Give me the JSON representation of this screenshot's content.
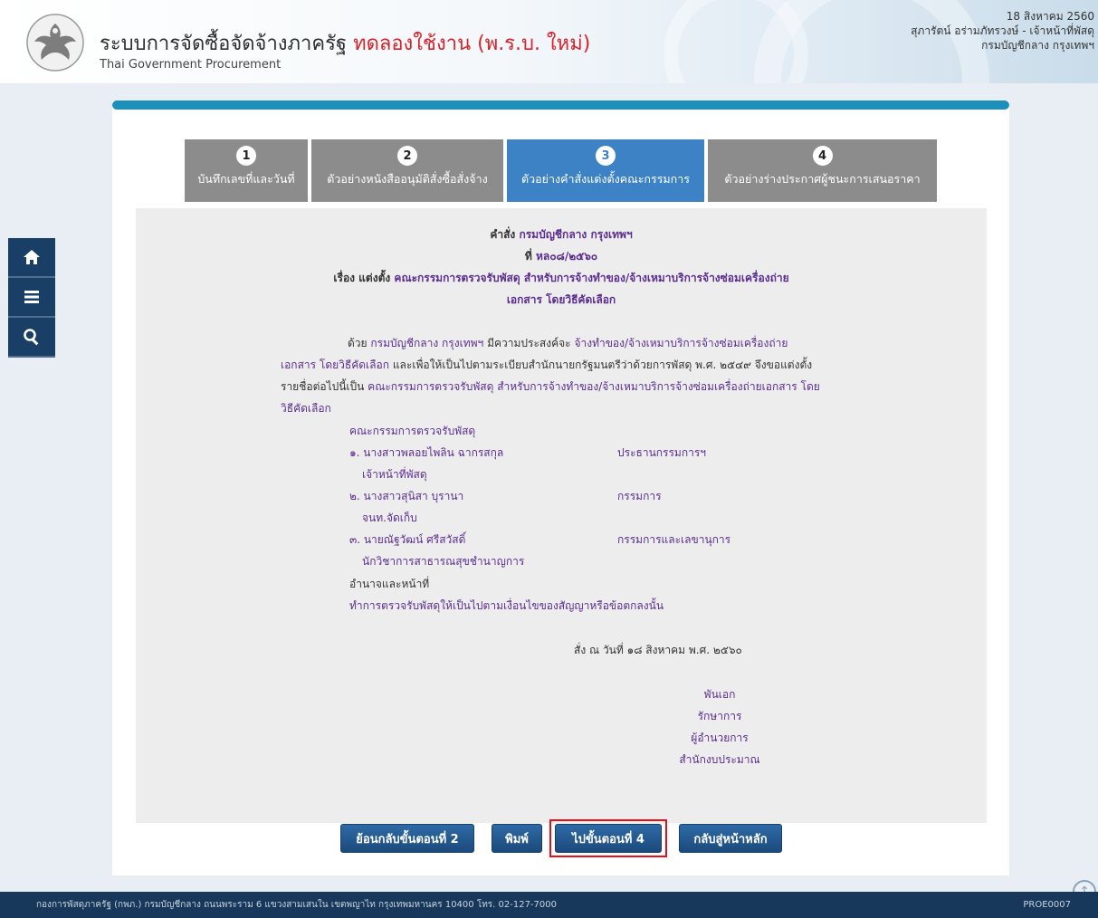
{
  "header": {
    "title": "ระบบการจัดซื้อจัดจ้างภาครัฐ",
    "trial_label": "ทดลองใช้งาน (พ.ร.บ. ใหม่)",
    "subtitle": "Thai Government Procurement",
    "date": "18 สิงหาคม 2560",
    "user": "สุภารัตน์ อร่ามภัทรวงษ์ - เจ้าหน้าที่พัสดุ",
    "department": "กรมบัญชีกลาง กรุงเทพฯ"
  },
  "leftnav": {
    "items": [
      {
        "icon": "home-icon"
      },
      {
        "icon": "menu-icon"
      },
      {
        "icon": "search-icon"
      }
    ]
  },
  "steps": [
    {
      "number": "1",
      "label": "บันทึกเลขที่และวันที่",
      "active": false
    },
    {
      "number": "2",
      "label": "ตัวอย่างหนังสืออนุมัติสั่งซื้อสั่งจ้าง",
      "active": false
    },
    {
      "number": "3",
      "label": "ตัวอย่างคำสั่งแต่งตั้งคณะกรรมการ",
      "active": true
    },
    {
      "number": "4",
      "label": "ตัวอย่างร่างประกาศผู้ชนะการเสนอราคา",
      "active": false
    }
  ],
  "document": {
    "order_prefix": "คำสั่ง",
    "order_dept": "กรมบัญชีกลาง กรุงเทพฯ",
    "number_prefix": "ที่",
    "number": "หล๐๘/๒๕๖๐",
    "subject_prefix": "เรื่อง แต่งตั้ง",
    "subject_line1": "คณะกรรมการตรวจรับพัสดุ สำหรับการจ้างทำของ/จ้างเหมาบริการจ้างซ่อมเครื่องถ่าย",
    "subject_line2": "เอกสาร โดยวิธีคัดเลือก",
    "para1_prefix": "ด้วย",
    "para1_dept": "กรมบัญชีกลาง กรุงเทพฯ",
    "para1_mid": "มีความประสงค์จะ",
    "para1_purpose": "จ้างทำของ/จ้างเหมาบริการจ้างซ่อมเครื่องถ่าย",
    "para2_purpose": "เอกสาร โดยวิธีคัดเลือก",
    "para2_text": "และเพื่อให้เป็นไปตามระเบียบสำนักนายกรัฐมนตรีว่าด้วยการพัสดุ พ.ศ. ๒๕๔๙ จึงขอแต่งตั้ง",
    "para3_text": "รายชื่อต่อไปนี้เป็น",
    "para3_purpose": "คณะกรรมการตรวจรับพัสดุ สำหรับการจ้างทำของ/จ้างเหมาบริการจ้างซ่อมเครื่องถ่ายเอกสาร โดย",
    "para4_purpose": "วิธีคัดเลือก",
    "committee_title": "คณะกรรมการตรวจรับพัสดุ",
    "members": [
      {
        "name": "๑. นางสาวพลอยไพลิน ฉากรสกุล",
        "position": "เจ้าหน้าที่พัสดุ",
        "role": "ประธานกรรมการฯ"
      },
      {
        "name": "๒. นางสาวสุนิสา บุรานา",
        "position": "จนท.จัดเก็บ",
        "role": "กรรมการ"
      },
      {
        "name": "๓. นายณัฐวัฒน์ ศรีสวัสดิ์",
        "position": "นักวิชาการสาธารณสุขชำนาญการ",
        "role": "กรรมการและเลขานุการ"
      }
    ],
    "duty_title": "อำนาจและหน้าที่",
    "duty_text": "ทำการตรวจรับพัสดุให้เป็นไปตามเงื่อนไขของสัญญาหรือข้อตกลงนั้น",
    "ordered_date": "สั่ง ณ วันที่  ๑๘ สิงหาคม พ.ศ. ๒๕๖๐",
    "signer": "พันเอก",
    "signer_title1": "รักษาการ",
    "signer_title2": "ผู้อำนวยการ",
    "signer_title3": "สำนักงบประมาณ"
  },
  "actions": {
    "back_label": "ย้อนกลับขั้นตอนที่ 2",
    "print_label": "พิมพ์",
    "next_label": "ไปขั้นตอนที่ 4",
    "home_label": "กลับสู่หน้าหลัก"
  },
  "footer": {
    "text": "กองการพัสดุภาครัฐ (กพภ.) กรมบัญชีกลาง ถนนพระราม 6 แขวงสามเสนใน เขตพญาไท กรุงเทพมหานคร 10400 โทร. 02-127-7000",
    "code": "PROE0007"
  }
}
